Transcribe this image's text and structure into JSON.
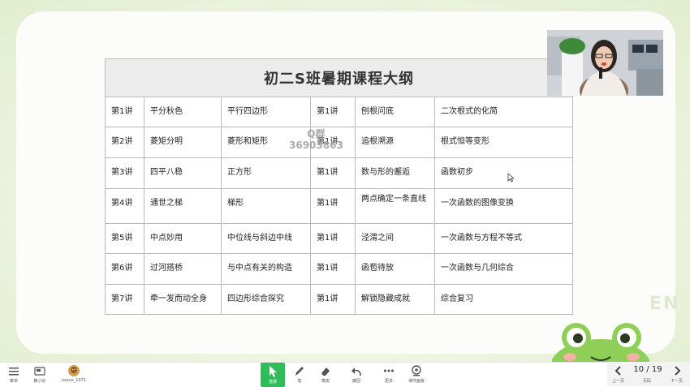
{
  "slide": {
    "title": "初二S班暑期课程大纲",
    "rows": [
      [
        "第1讲",
        "平分秋色",
        "平行四边形",
        "第1讲",
        "刨根问底",
        "二次根式的化简"
      ],
      [
        "第2讲",
        "菱矩分明",
        "菱形和矩形",
        "第1讲",
        "追根溯源",
        "根式恒等变形"
      ],
      [
        "第3讲",
        "四平八稳",
        "正方形",
        "第1讲",
        "数与形的邂逅",
        "函数初步"
      ],
      [
        "第4讲",
        "通世之梯",
        "梯形",
        "第1讲",
        "两点确定一条直线",
        "一次函数的图像变换"
      ],
      [
        "第5讲",
        "中点妙用",
        "中位线与斜边中线",
        "第1讲",
        "泾渭之间",
        "一次函数与方程不等式"
      ],
      [
        "第6讲",
        "过河搭桥",
        "与中点有关的构造",
        "第1讲",
        "函苞待放",
        "一次函数与几何综合"
      ],
      [
        "第7讲",
        "牵一发而动全身",
        "四边形综合探究",
        "第1讲",
        "解锁隐藏成就",
        "综合复习"
      ]
    ],
    "watermark_line1": "Q群",
    "watermark_line2": "36903863",
    "corner_watermark": "EN"
  },
  "toolbar": {
    "left": [
      {
        "name": "菜单",
        "icon": "menu-icon"
      },
      {
        "name": "教小伦",
        "icon": "whiteboard-icon"
      },
      {
        "name": "xxxxx_1971",
        "icon": "avatar-icon"
      }
    ],
    "tools": [
      {
        "name": "选择",
        "icon": "cursor-icon"
      },
      {
        "name": "笔",
        "icon": "pen-icon"
      },
      {
        "name": "橡皮",
        "icon": "eraser-icon"
      },
      {
        "name": "撤回",
        "icon": "undo-icon"
      },
      {
        "name": "更多",
        "icon": "more-icon"
      },
      {
        "name": "课件面板",
        "icon": "courseware-icon"
      }
    ],
    "page": {
      "current": "10 / 19",
      "prev_label": "上一页",
      "next_label": "下一页",
      "jump_label": "页码"
    }
  },
  "colors": {
    "accent": "#2fbd5b",
    "header_bg": "#ececec",
    "frog": "#8fcf57"
  }
}
